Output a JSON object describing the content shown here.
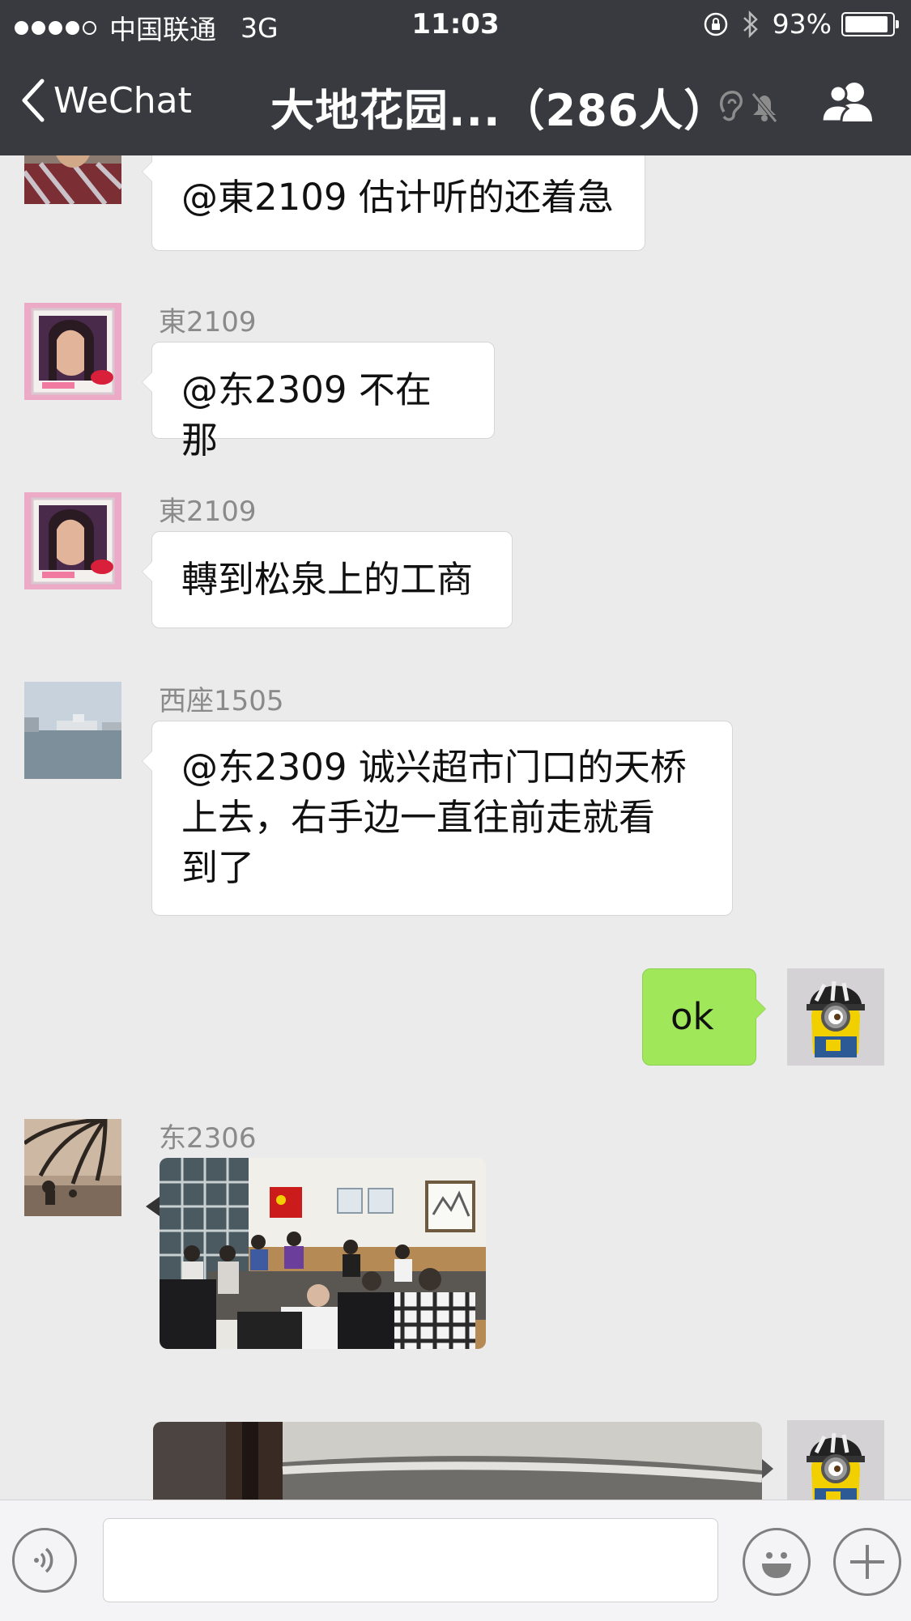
{
  "status_bar": {
    "carrier": "中国联通",
    "network": "3G",
    "time": "11:03",
    "battery_text": "93%",
    "battery_level": 0.93
  },
  "nav": {
    "back_label": "WeChat",
    "title": "大地花园...（286人）"
  },
  "messages": [
    {
      "sender": "",
      "text": "@東2109 估计听的还着急"
    },
    {
      "sender": "東2109",
      "text": "@东2309 不在那"
    },
    {
      "sender": "東2109",
      "text": "轉到松泉上的工商"
    },
    {
      "sender": "西座1505",
      "text_lines": [
        "@东2309 诚兴超市门口的天桥",
        "上去，右手边一直往前走就看",
        "到了"
      ]
    },
    {
      "sender": "me",
      "text": "ok"
    },
    {
      "sender": "东2306",
      "type": "image"
    },
    {
      "sender": "me",
      "type": "image"
    }
  ],
  "input": {
    "value": "",
    "placeholder": ""
  },
  "colors": {
    "nav_bg": "#393a3f",
    "chat_bg": "#ebebeb",
    "my_bubble": "#a0e75a",
    "other_bubble": "#ffffff"
  },
  "icons": [
    "back-chevron-icon",
    "mute-icon",
    "group-members-icon",
    "voice-icon",
    "emoji-icon",
    "plus-icon"
  ]
}
